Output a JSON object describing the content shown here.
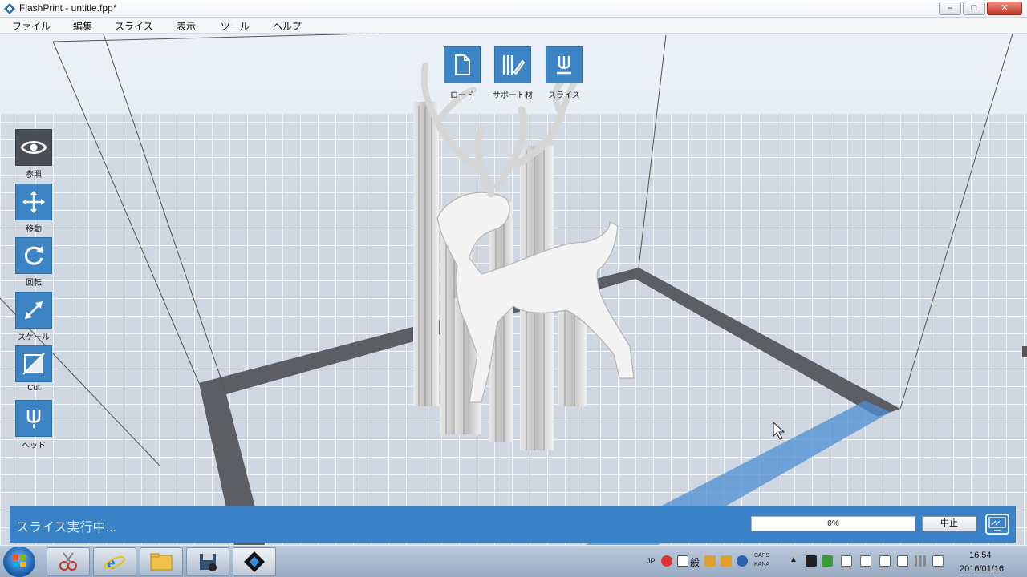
{
  "window": {
    "title": "FlashPrint - untitle.fpp*",
    "minimize_icon": "minimize-icon",
    "maximize_icon": "maximize-icon",
    "close_icon": "close-icon"
  },
  "menu": {
    "items": [
      {
        "label": "ファイル"
      },
      {
        "label": "編集"
      },
      {
        "label": "スライス"
      },
      {
        "label": "表示"
      },
      {
        "label": "ツール"
      },
      {
        "label": "ヘルプ"
      }
    ]
  },
  "top_toolbar": {
    "items": [
      {
        "label": "ロード",
        "icon": "load-file-icon"
      },
      {
        "label": "サポート材",
        "icon": "support-icon"
      },
      {
        "label": "スライス",
        "icon": "slice-icon"
      }
    ]
  },
  "left_toolbar": {
    "items": [
      {
        "label": "参照",
        "icon": "eye-icon"
      },
      {
        "label": "移動",
        "icon": "move-icon"
      },
      {
        "label": "回転",
        "icon": "rotate-icon"
      },
      {
        "label": "スケール",
        "icon": "scale-icon"
      },
      {
        "label": "Cut",
        "icon": "cut-icon"
      },
      {
        "label": "ヘッド",
        "icon": "nozzle-icon"
      }
    ]
  },
  "status": {
    "message": "スライス実行中...",
    "progress_label": "0%",
    "progress_value": 0,
    "stop_label": "中止",
    "monitor_icon": "monitor-icon"
  },
  "taskbar": {
    "apps": [
      "start-orb-icon",
      "snipping-tool-icon",
      "internet-explorer-icon",
      "file-explorer-icon",
      "media-app-icon",
      "flashprint-icon"
    ],
    "tray": {
      "lang": "JP",
      "caps": "CAPS",
      "kana": "KANA",
      "kanji_mode": "般"
    },
    "clock": {
      "time": "16:54",
      "date": "2016/01/16"
    }
  },
  "colors": {
    "accent": "#3d84c5",
    "status_bar": "#3a82c7",
    "dark_tool": "#4a4f57"
  }
}
